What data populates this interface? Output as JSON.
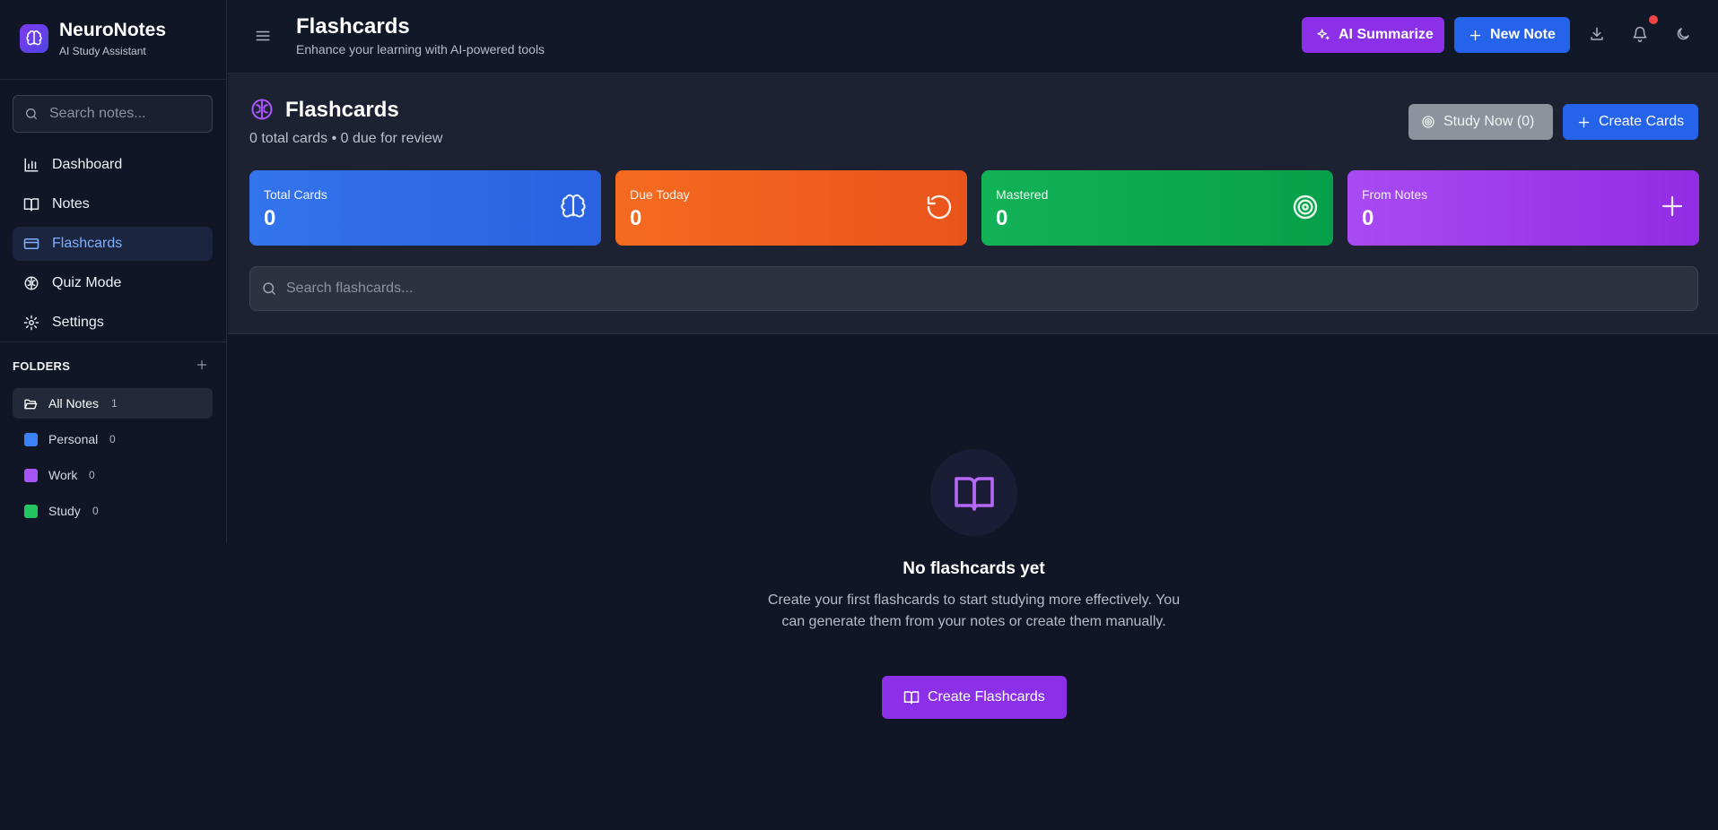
{
  "app": {
    "name": "NeuroNotes",
    "tagline": "AI Study Assistant"
  },
  "sidebar": {
    "search_placeholder": "Search notes...",
    "nav": [
      {
        "label": "Dashboard",
        "icon": "bar-chart-icon"
      },
      {
        "label": "Notes",
        "icon": "book-icon"
      },
      {
        "label": "Flashcards",
        "icon": "card-icon",
        "active": true
      },
      {
        "label": "Quiz Mode",
        "icon": "brain-icon"
      },
      {
        "label": "Settings",
        "icon": "gear-icon"
      }
    ],
    "folders_title": "FOLDERS",
    "folders": [
      {
        "label": "All Notes",
        "count": "1",
        "icon": "folder-open-icon",
        "active": true
      },
      {
        "label": "Personal",
        "count": "0",
        "color": "#3b82f6"
      },
      {
        "label": "Work",
        "count": "0",
        "color": "#a855f7"
      },
      {
        "label": "Study",
        "count": "0",
        "color": "#22c55e"
      }
    ]
  },
  "topbar": {
    "title": "Flashcards",
    "subtitle": "Enhance your learning with AI-powered tools",
    "ai_summarize_label": "AI Summarize",
    "new_note_label": "New Note"
  },
  "flashcards": {
    "title": "Flashcards",
    "summary": "0 total cards • 0 due for review",
    "study_now_label": "Study Now (0)",
    "create_cards_label": "Create Cards",
    "stats": {
      "total": {
        "label": "Total Cards",
        "value": "0"
      },
      "due": {
        "label": "Due Today",
        "value": "0"
      },
      "mastered": {
        "label": "Mastered",
        "value": "0"
      },
      "from_notes": {
        "label": "From Notes",
        "value": "0"
      }
    },
    "search_placeholder": "Search flashcards..."
  },
  "empty_state": {
    "title": "No flashcards yet",
    "description": "Create your first flashcards to start studying more effectively. You can generate them from your notes or create them manually.",
    "button_label": "Create Flashcards"
  },
  "colors": {
    "accent_blue": "#2563eb",
    "accent_purple": "#8b30e8",
    "background": "#101625",
    "notification": "#ef4444"
  }
}
